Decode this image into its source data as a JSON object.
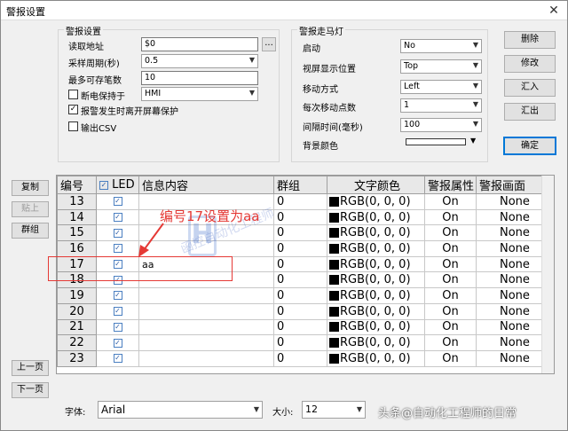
{
  "window": {
    "title": "警报设置",
    "close_glyph": "✕"
  },
  "alarm_settings": {
    "group_title": "警报设置",
    "read_address_label": "读取地址",
    "read_address_value": "$0",
    "browse_label": "...",
    "sample_period_label": "采样周期(秒)",
    "sample_period_value": "0.5",
    "max_records_label": "最多可存笔数",
    "max_records_value": "10",
    "retain_label": "断电保持于",
    "retain_value": "HMI",
    "retain_checked": false,
    "leave_saver_label": "报警发生时离开屏幕保护",
    "leave_saver_checked": true,
    "csv_label": "输出CSV",
    "csv_checked": false
  },
  "marquee": {
    "group_title": "警报走马灯",
    "start_label": "启动",
    "start_value": "No",
    "position_label": "视屏显示位置",
    "position_value": "Top",
    "move_label": "移动方式",
    "move_value": "Left",
    "points_label": "每次移动点数",
    "points_value": "1",
    "interval_label": "间隔时间(毫秒)",
    "interval_value": "100",
    "bg_label": "背景颜色",
    "bg_color": "#ffffff"
  },
  "buttons": {
    "delete": "删除",
    "modify": "修改",
    "import": "汇入",
    "export": "汇出",
    "ok": "确定",
    "copy": "复制",
    "paste": "贴上",
    "group": "群组",
    "prev_page": "上一页",
    "next_page": "下一页"
  },
  "table": {
    "headers": [
      "编号",
      "LED",
      "信息内容",
      "群组",
      "文字颜色",
      "警报属性",
      "警报画面"
    ],
    "led_header_checked": true,
    "rows": [
      {
        "num": "13",
        "led": true,
        "msg": "",
        "group": "0",
        "color": "RGB(0, 0, 0)",
        "attr": "On",
        "screen": "None"
      },
      {
        "num": "14",
        "led": true,
        "msg": "",
        "group": "0",
        "color": "RGB(0, 0, 0)",
        "attr": "On",
        "screen": "None"
      },
      {
        "num": "15",
        "led": true,
        "msg": "",
        "group": "0",
        "color": "RGB(0, 0, 0)",
        "attr": "On",
        "screen": "None"
      },
      {
        "num": "16",
        "led": true,
        "msg": "",
        "group": "0",
        "color": "RGB(0, 0, 0)",
        "attr": "On",
        "screen": "None"
      },
      {
        "num": "17",
        "led": true,
        "msg": "aa",
        "group": "0",
        "color": "RGB(0, 0, 0)",
        "attr": "On",
        "screen": "None"
      },
      {
        "num": "18",
        "led": true,
        "msg": "",
        "group": "0",
        "color": "RGB(0, 0, 0)",
        "attr": "On",
        "screen": "None"
      },
      {
        "num": "19",
        "led": true,
        "msg": "",
        "group": "0",
        "color": "RGB(0, 0, 0)",
        "attr": "On",
        "screen": "None"
      },
      {
        "num": "20",
        "led": true,
        "msg": "",
        "group": "0",
        "color": "RGB(0, 0, 0)",
        "attr": "On",
        "screen": "None"
      },
      {
        "num": "21",
        "led": true,
        "msg": "",
        "group": "0",
        "color": "RGB(0, 0, 0)",
        "attr": "On",
        "screen": "None"
      },
      {
        "num": "22",
        "led": true,
        "msg": "",
        "group": "0",
        "color": "RGB(0, 0, 0)",
        "attr": "On",
        "screen": "None"
      },
      {
        "num": "23",
        "led": true,
        "msg": "",
        "group": "0",
        "color": "RGB(0, 0, 0)",
        "attr": "On",
        "screen": "None"
      }
    ]
  },
  "font_bar": {
    "font_label": "字体:",
    "font_value": "Arial",
    "size_label": "大小:",
    "size_value": "12"
  },
  "annotation": {
    "text": "编号17设置为aa",
    "color": "#e53935"
  },
  "watermark": {
    "text": "函控自动化工程师",
    "logo": "H"
  },
  "credit": "头条@自动化工程师的日常"
}
